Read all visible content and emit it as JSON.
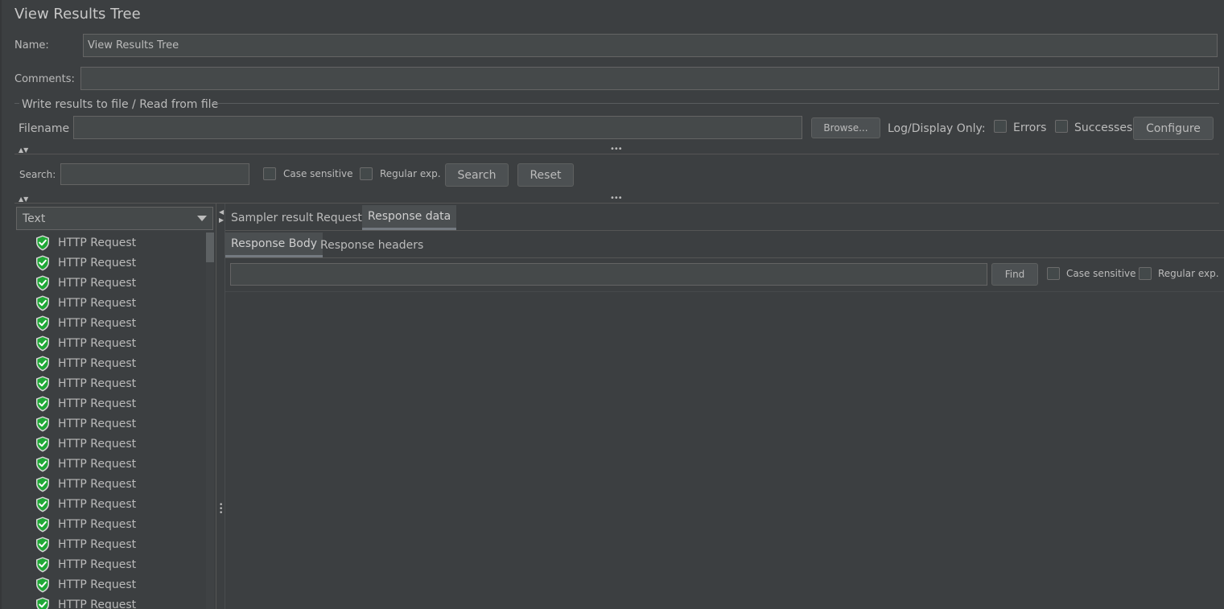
{
  "panel": {
    "title": "View Results Tree",
    "name_label": "Name:",
    "name_value": "View Results Tree",
    "comments_label": "Comments:",
    "comments_value": ""
  },
  "file_group": {
    "legend": "Write results to file / Read from file",
    "filename_label": "Filename",
    "filename_value": "",
    "browse_label": "Browse...",
    "log_display_label": "Log/Display Only:",
    "errors_label": "Errors",
    "successes_label": "Successes",
    "configure_label": "Configure"
  },
  "search_bar": {
    "search_label": "Search:",
    "search_value": "",
    "case_sensitive_label": "Case sensitive",
    "regular_exp_label": "Regular exp.",
    "search_button": "Search",
    "reset_button": "Reset"
  },
  "renderer": {
    "selected": "Text"
  },
  "tree": {
    "items": [
      {
        "label": "HTTP Request",
        "status": "success"
      },
      {
        "label": "HTTP Request",
        "status": "success"
      },
      {
        "label": "HTTP Request",
        "status": "success"
      },
      {
        "label": "HTTP Request",
        "status": "success"
      },
      {
        "label": "HTTP Request",
        "status": "success"
      },
      {
        "label": "HTTP Request",
        "status": "success"
      },
      {
        "label": "HTTP Request",
        "status": "success"
      },
      {
        "label": "HTTP Request",
        "status": "success"
      },
      {
        "label": "HTTP Request",
        "status": "success"
      },
      {
        "label": "HTTP Request",
        "status": "success"
      },
      {
        "label": "HTTP Request",
        "status": "success"
      },
      {
        "label": "HTTP Request",
        "status": "success"
      },
      {
        "label": "HTTP Request",
        "status": "success"
      },
      {
        "label": "HTTP Request",
        "status": "success"
      },
      {
        "label": "HTTP Request",
        "status": "success"
      },
      {
        "label": "HTTP Request",
        "status": "success"
      },
      {
        "label": "HTTP Request",
        "status": "success"
      },
      {
        "label": "HTTP Request",
        "status": "success"
      },
      {
        "label": "HTTP Request",
        "status": "success"
      }
    ]
  },
  "result_tabs": {
    "tabs": [
      "Sampler result",
      "Request",
      "Response data"
    ],
    "selected": "Response data"
  },
  "response_tabs": {
    "tabs": [
      "Response Body",
      "Response headers"
    ],
    "selected": "Response Body"
  },
  "find_bar": {
    "find_value": "",
    "find_button": "Find",
    "case_sensitive_label": "Case sensitive",
    "regular_exp_label": "Regular exp."
  },
  "colors": {
    "background": "#3c3f41",
    "field": "#45494a",
    "success_icon": "#1fa836"
  },
  "icons": [
    "success-shield-icon",
    "dropdown-arrow-icon",
    "collapse-arrows-icon",
    "splitter-dots-icon"
  ]
}
